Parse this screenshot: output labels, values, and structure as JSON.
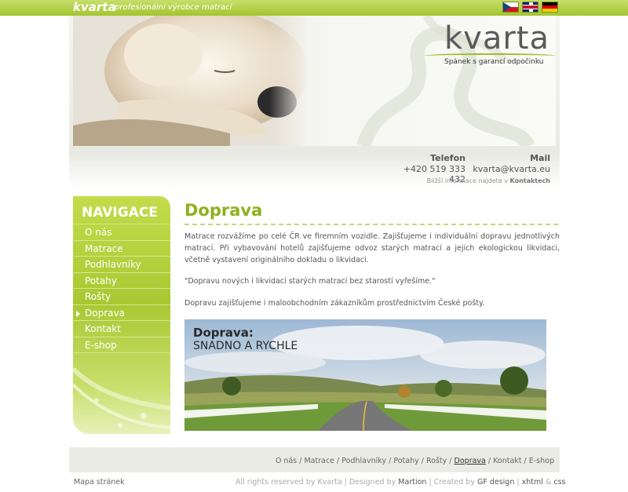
{
  "topbar": {
    "logo": "kvarta",
    "tagline": "profesionální výrobce matrací",
    "languages": [
      "cz-flag",
      "uk-flag",
      "de-flag"
    ]
  },
  "header": {
    "brand_name": "kvarta",
    "brand_slogan": "Spánek s garancí odpočinku"
  },
  "contact": {
    "phone_label": "Telefon",
    "phone_value": "+420 519 333 432",
    "mail_label": "Mail",
    "mail_value": "kvarta@kvarta.eu",
    "note_prefix": "Bližší informace najdete v",
    "note_link": "Kontaktech"
  },
  "nav": {
    "title": "NAVIGACE",
    "items": [
      {
        "label": "O nás"
      },
      {
        "label": "Matrace"
      },
      {
        "label": "Podhlavníky"
      },
      {
        "label": "Potahy"
      },
      {
        "label": "Rošty"
      },
      {
        "label": "Doprava"
      },
      {
        "label": "Kontakt"
      },
      {
        "label": "E-shop"
      }
    ],
    "active": "Doprava"
  },
  "main": {
    "title": "Doprava",
    "paragraph1": "Matrace rozvážíme po celé ČR ve firemním vozidle. Zajišťujeme i individuální dopravu jednotlivých matrací. Při vybavování hotelů zajišťujeme odvoz starých matrací a jejich ekologickou likvidaci, včetně vystavení originálního dokladu o likvidaci.",
    "paragraph2": "\"Dopravu nových i likvidaci starých matrací bez starostí vyřešíme.\"",
    "paragraph3": "Dopravu zajišťujeme i maloobchodním zákazníkům prostřednictvím České pošty.",
    "photo_title": "Doprava:",
    "photo_subtitle": "SNADNO A RYCHLE"
  },
  "footer": {
    "links": [
      "O nás",
      "Matrace",
      "Podhlavníky",
      "Potahy",
      "Rošty",
      "Doprava",
      "Kontakt",
      "E-shop"
    ],
    "current": "Doprava",
    "sitemap": "Mapa stránek",
    "rights": "All rights reserved by Kvarta",
    "designed_by_prefix": "Designed by",
    "designer": "Martion",
    "created_by_prefix": "Created by",
    "creator": "GF design",
    "tech1": "xhtml",
    "tech_and": "&",
    "tech2": "css"
  },
  "colors": {
    "accent": "#8eb11e",
    "topbar": "#a3c52f",
    "nav": "#a8c833"
  }
}
